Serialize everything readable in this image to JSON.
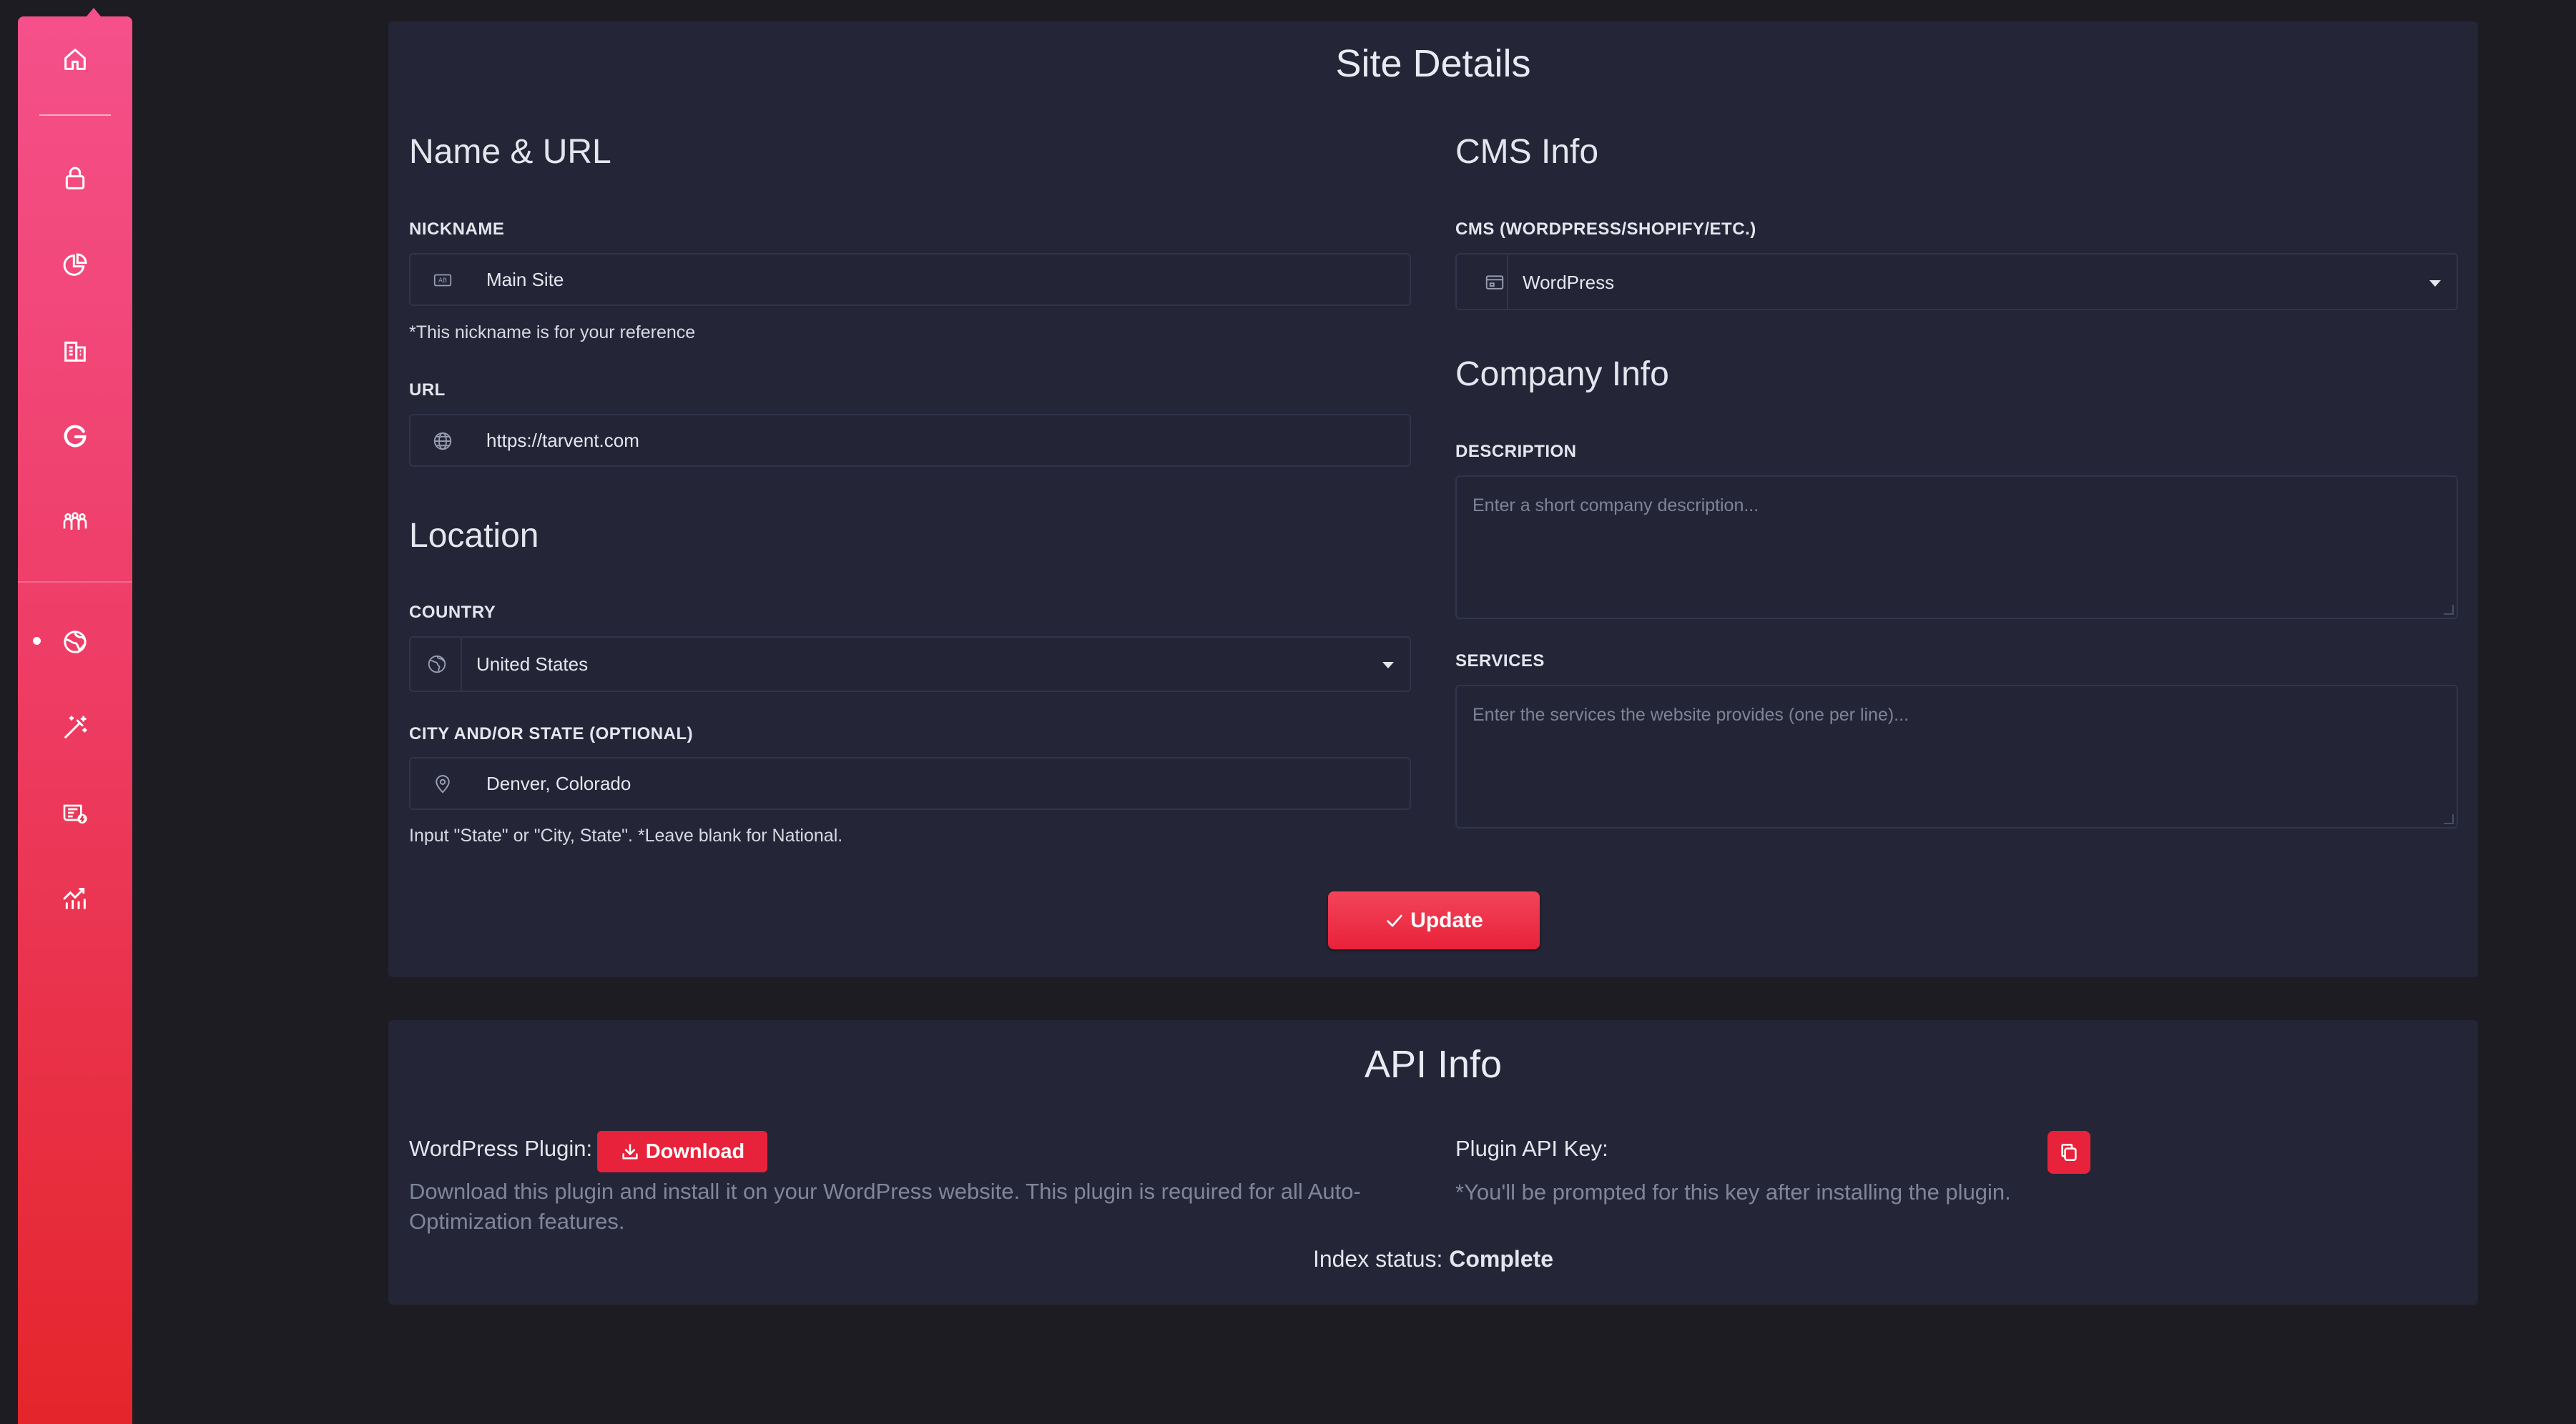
{
  "site_details": {
    "title": "Site Details",
    "name_url": {
      "heading": "Name & URL",
      "nickname_label": "NICKNAME",
      "nickname_value": "Main Site",
      "nickname_help": "*This nickname is for your reference",
      "url_label": "URL",
      "url_value": "https://tarvent.com"
    },
    "location": {
      "heading": "Location",
      "country_label": "COUNTRY",
      "country_value": "United States",
      "city_label": "CITY AND/OR STATE (OPTIONAL)",
      "city_value": "Denver, Colorado",
      "city_help": "Input \"State\" or \"City, State\". *Leave blank for National."
    },
    "cms": {
      "heading": "CMS Info",
      "label": "CMS (WORDPRESS/SHOPIFY/ETC.)",
      "value": "WordPress"
    },
    "company": {
      "heading": "Company Info",
      "description_label": "DESCRIPTION",
      "description_placeholder": "Enter a short company description...",
      "services_label": "SERVICES",
      "services_placeholder": "Enter the services the website provides (one per line)..."
    },
    "update_label": "Update"
  },
  "api_info": {
    "title": "API Info",
    "plugin_label": "WordPress Plugin:",
    "download_label": "Download",
    "plugin_desc_line1": "Download this plugin and install it on your WordPress website. This plugin is required for all Auto-",
    "plugin_desc_line2": "Optimization features.",
    "api_key_label": "Plugin API Key:",
    "api_key_note": "*You'll be prompted for this key after installing the plugin.",
    "index_status_label": "Index status:",
    "index_status_value": "Complete"
  },
  "sidebar": {
    "icons": [
      "home-icon",
      "lock-icon",
      "pie-chart-icon",
      "building-icon",
      "google-icon",
      "team-icon",
      "globe-icon",
      "magic-wand-icon",
      "news-icon",
      "analytics-icon"
    ],
    "active": "globe-icon"
  },
  "colors": {
    "accent": "#e8223a",
    "sidebar_top": "#f5508a",
    "sidebar_bottom": "#e4252b",
    "card_bg": "#242637",
    "page_bg": "#1c1c22"
  }
}
